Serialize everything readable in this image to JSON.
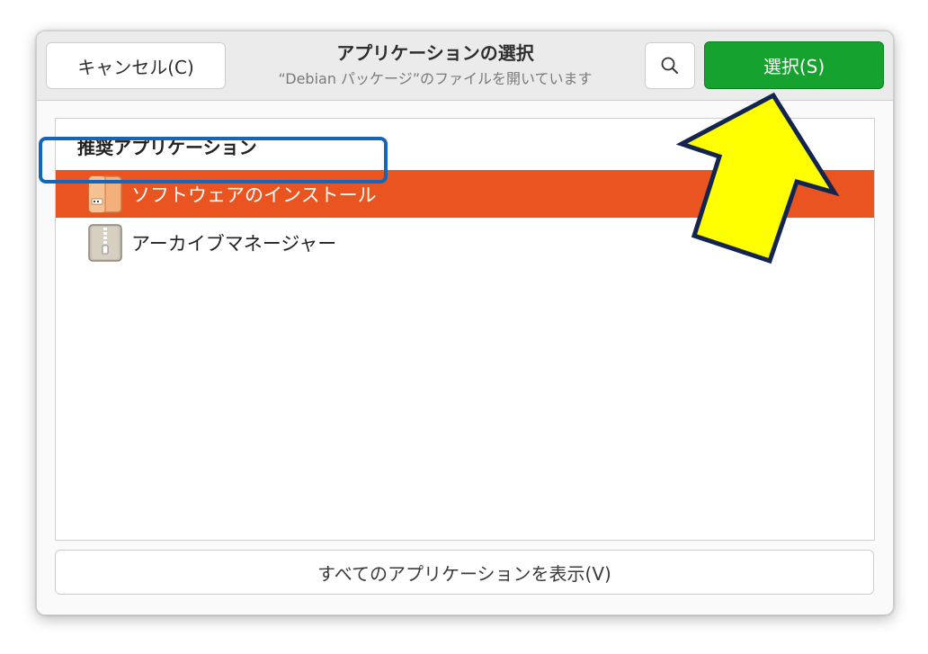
{
  "dialog": {
    "title": "アプリケーションの選択",
    "subtitle": "“Debian パッケージ”のファイルを開いています",
    "cancel_label": "キャンセル(C)",
    "select_label": "選択(S)",
    "search_icon": "search-icon"
  },
  "list": {
    "heading": "推奨アプリケーション",
    "items": [
      {
        "label": "ソフトウェアのインストール",
        "icon": "software-install-icon",
        "selected": true
      },
      {
        "label": "アーカイブマネージャー",
        "icon": "archive-manager-icon",
        "selected": false
      }
    ]
  },
  "footer": {
    "show_all_label": "すべてのアプリケーションを表示(V)"
  },
  "colors": {
    "selection": "#e95420",
    "primary_button": "#16a22f",
    "callout_arrow": "#ffff00",
    "callout_box": "#1565b8"
  }
}
